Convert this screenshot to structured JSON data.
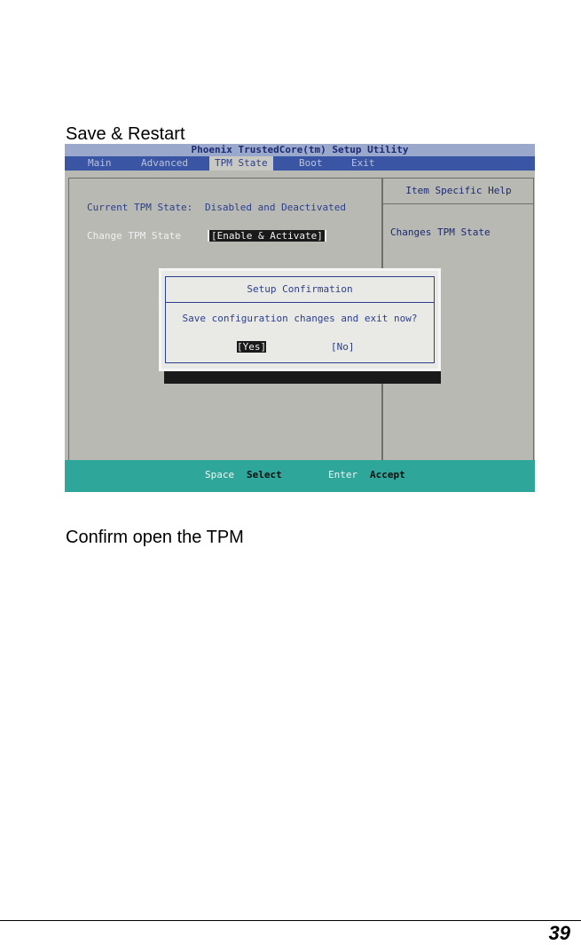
{
  "page": {
    "heading": "Save & Restart",
    "caption": "Confirm open the TPM",
    "page_number": "39"
  },
  "bios": {
    "title": "Phoenix TrustedCore(tm) Setup Utility",
    "menu": [
      "Main",
      "Advanced",
      "TPM State",
      "Boot",
      "Exit"
    ],
    "active_menu": "TPM State",
    "current_state_label": "Current TPM State:",
    "current_state_value": "Disabled and Deactivated",
    "change_state_label": "Change TPM State",
    "change_state_value": "[Enable & Activate]",
    "help_title": "Item Specific Help",
    "help_text": "Changes TPM State",
    "dialog": {
      "title": "Setup Confirmation",
      "message": "Save configuration changes and exit now?",
      "yes_label": "[Yes]",
      "no_label": "[No]",
      "selected": "Yes"
    },
    "status": {
      "key1": "Space",
      "action1": "Select",
      "key2": "Enter",
      "action2": "Accept"
    },
    "colors": {
      "menubar": "#3a55a3",
      "statusbar": "#2ea79a",
      "body": "#b9b9b4"
    }
  }
}
